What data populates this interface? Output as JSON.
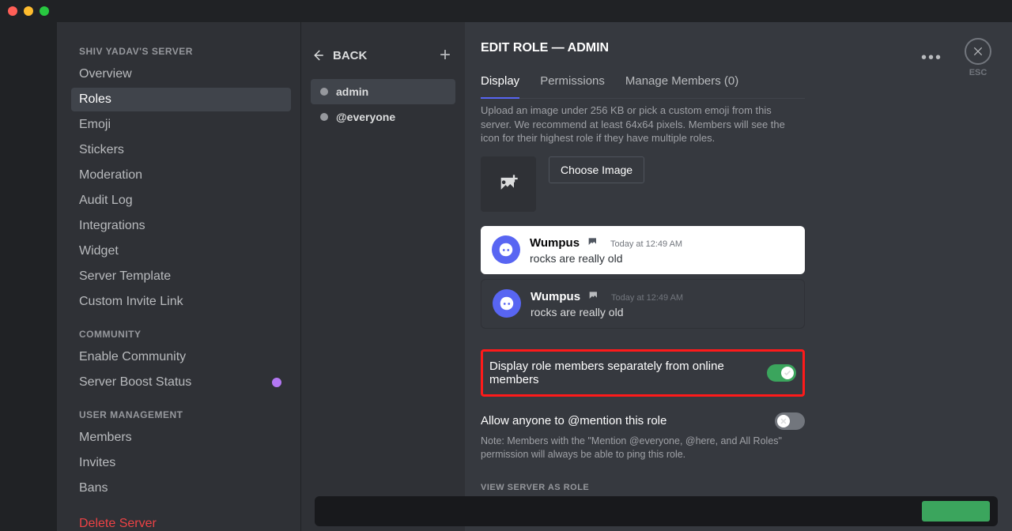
{
  "server_name": "SHIV YADAV'S SERVER",
  "sidebar": {
    "groups": [
      {
        "items": [
          {
            "label": "Overview",
            "bind": "sidebar.groups.0.items.0.label"
          },
          {
            "label": "Roles",
            "active": true
          },
          {
            "label": "Emoji"
          },
          {
            "label": "Stickers"
          },
          {
            "label": "Moderation"
          },
          {
            "label": "Audit Log"
          },
          {
            "label": "Integrations"
          },
          {
            "label": "Widget"
          },
          {
            "label": "Server Template"
          },
          {
            "label": "Custom Invite Link"
          }
        ]
      },
      {
        "header": "COMMUNITY",
        "items": [
          {
            "label": "Enable Community"
          },
          {
            "label": "Server Boost Status",
            "boost": true
          }
        ]
      },
      {
        "header": "USER MANAGEMENT",
        "items": [
          {
            "label": "Members"
          },
          {
            "label": "Invites"
          },
          {
            "label": "Bans"
          }
        ]
      }
    ],
    "delete_label": "Delete Server"
  },
  "rolecol": {
    "back": "BACK",
    "roles": [
      {
        "name": "admin",
        "selected": true
      },
      {
        "name": "@everyone"
      }
    ]
  },
  "main": {
    "title": "EDIT ROLE — ADMIN",
    "tabs": [
      {
        "label": "Display",
        "active": true
      },
      {
        "label": "Permissions"
      },
      {
        "label": "Manage Members (0)"
      }
    ],
    "help": "Upload an image under 256 KB or pick a custom emoji from this server. We recommend at least 64x64 pixels. Members will see the icon for their highest role if they have multiple roles.",
    "choose_image": "Choose Image",
    "preview": {
      "name": "Wumpus",
      "timestamp": "Today at 12:49 AM",
      "body": "rocks are really old"
    },
    "setting_display_separate": {
      "title": "Display role members separately from online members",
      "on": true
    },
    "setting_mention": {
      "title": "Allow anyone to @mention this role",
      "note": "Note: Members with the \"Mention @everyone, @here, and All Roles\" permission will always be able to ping this role.",
      "on": false
    },
    "view_as": "VIEW SERVER AS ROLE",
    "esc": "ESC"
  }
}
